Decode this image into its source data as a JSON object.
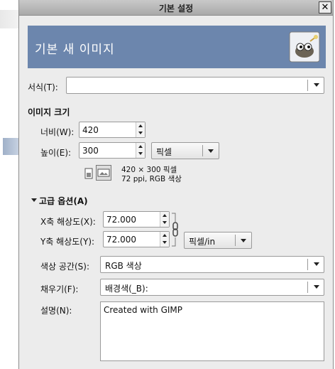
{
  "window": {
    "title": "기본 설정",
    "close_glyph": "✕"
  },
  "banner": {
    "title": "기본 새 이미지",
    "logo_icon": "gimp-wilber-icon"
  },
  "template": {
    "label": "서식(T):",
    "value": ""
  },
  "image_size": {
    "heading": "이미지 크기",
    "width_label": "너비(W):",
    "width_value": "420",
    "height_label": "높이(E):",
    "height_value": "300",
    "unit": "픽셀",
    "info_line1": "420 × 300 픽셀",
    "info_line2": "72 ppi, RGB 색상"
  },
  "advanced": {
    "heading": "고급 옵션(A)",
    "xres_label": "X축 해상도(X):",
    "xres_value": "72.000",
    "yres_label": "Y축 해상도(Y):",
    "yres_value": "72.000",
    "res_unit": "픽셀/in",
    "colorspace_label": "색상 공간(S):",
    "colorspace_value": "RGB 색상",
    "fill_label": "채우기(F):",
    "fill_value": "배경색(_B):",
    "comment_label": "설명(N):",
    "comment_value": "Created with GIMP"
  },
  "colors": {
    "banner": "#6c86ad",
    "window_bg": "#ececec"
  }
}
